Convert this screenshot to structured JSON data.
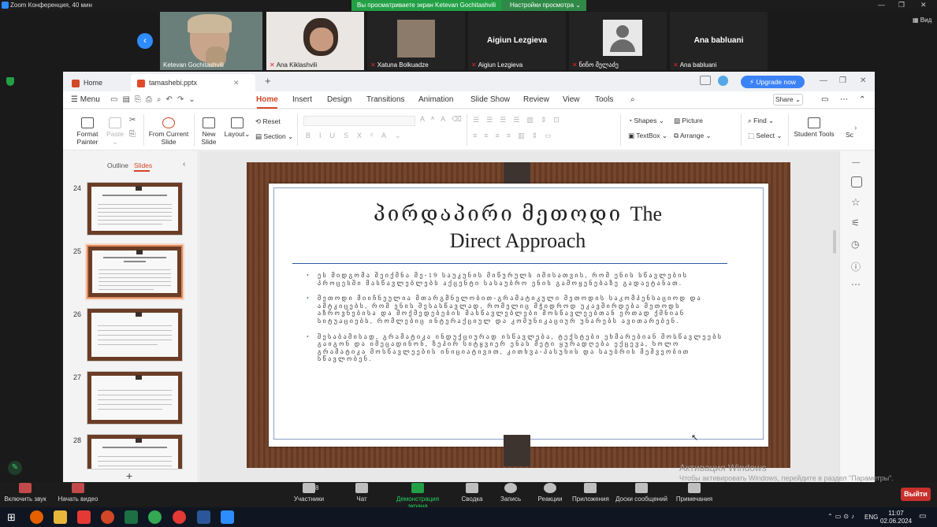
{
  "zoom": {
    "window_title": "Zoom Конференция, 40 мин",
    "share_banner": "Вы просматриваете экран Ketevan Gochitashvili",
    "view_settings": "Настройки просмотра",
    "view_button": "Вид",
    "participants": [
      {
        "name": "Ketevan Gochitashvili",
        "muted": false,
        "video": true
      },
      {
        "name": "Ana Kiklashvili",
        "muted": true,
        "video": true
      },
      {
        "name": "Xatuna Bolkuadze",
        "muted": true,
        "video": true
      },
      {
        "name": "Aigiun Lezgieva",
        "muted": true,
        "video": false,
        "center_label": "Aigiun Lezgieva"
      },
      {
        "name": "ნინო მელაძე",
        "muted": true,
        "video": false
      },
      {
        "name": "Ana babluani",
        "muted": true,
        "video": false,
        "center_label": "Ana babluani"
      }
    ],
    "controls": {
      "mute": "Включить звук",
      "video": "Начать видео",
      "participants": "Участники",
      "participants_count": "8",
      "chat": "Чат",
      "share": "Демонстрация экрана",
      "summary": "Сводка",
      "record": "Запись",
      "reactions": "Реакции",
      "apps": "Приложения",
      "whiteboards": "Доски сообщений",
      "notes": "Примечания",
      "leave": "Выйти"
    }
  },
  "wps": {
    "tabs": {
      "home": "Home",
      "file": "tamashebi.pptx"
    },
    "upgrade": "Upgrade now",
    "menu_label": "Menu",
    "menu_tabs": [
      "Home",
      "Insert",
      "Design",
      "Transitions",
      "Animation",
      "Slide Show",
      "Review",
      "View",
      "Tools"
    ],
    "share": "Share",
    "ribbon": {
      "format_painter": "Format\nPainter",
      "paste": "Paste",
      "from_current_slide": "From Current\nSlide",
      "new_slide": "New\nSlide",
      "layout": "Layout",
      "reset": "Reset",
      "section": "Section",
      "shapes": "Shapes",
      "picture": "Picture",
      "find": "Find",
      "textbox": "TextBox",
      "arrange": "Arrange",
      "select": "Select",
      "student_tools": "Student Tools",
      "trailing": "Sc"
    },
    "panel_tabs": {
      "outline": "Outline",
      "slides": "Slides"
    },
    "thumbnails": [
      {
        "num": "24",
        "selected": false
      },
      {
        "num": "25",
        "selected": true
      },
      {
        "num": "26",
        "selected": false
      },
      {
        "num": "27",
        "selected": false
      },
      {
        "num": "28",
        "selected": false
      }
    ],
    "slide": {
      "title_ka": "პირდაპირი მეთოდი",
      "title_en_1": "The",
      "title_en_2": "Direct Approach",
      "bullets": [
        "ეს მიდგომა შეიქმნა მე-19 საუკუნის მიწურულს იმისათვის, რომ ენის სწავლების პროცესში მასწავლებლებს აქცენტი სასაუბრო ენის გამოყენებაზე გადაეტანათ.",
        "მეთოდი მიიჩნეულია მთარგმნელობით-გრამატიკული მეთოდის საკომპენსაციოდ და ამტკიცებს, რომ ენის შესასწავლად, რომელიც მჭიდროდ უკავშირდება მეთოდს აზროვნებისა და მოქმედებების მასწავლებლები მოსწავლეებთან ერთად ქმნიან სიტუაციებს, რომლებიც ინტერაქციულ და კომუნიკაციურ უნარებს ავითარებენ.",
        "შესაბამისად, გრამატიკა ინდუქციურად ისწავლება, ტექსტები ეხმარებიან მოსწავლეებს გაიგონ და იმეცადინონ, ზეპირ სიტყვიერ ენას მეტი ყურადღება ექცევა, ხოლო გრამატიკა მოსწავლეების ინიციატივით, კითხვა-პასუხის და საუბრის მეშვეობით სწავლობენ."
      ]
    }
  },
  "watermark": {
    "line1": "Активация Windows",
    "line2": "Чтобы активировать Windows, перейдите в раздел \"Параметры\"."
  },
  "taskbar": {
    "lang": "ENG",
    "time": "11:07",
    "date": "02.06.2024"
  }
}
